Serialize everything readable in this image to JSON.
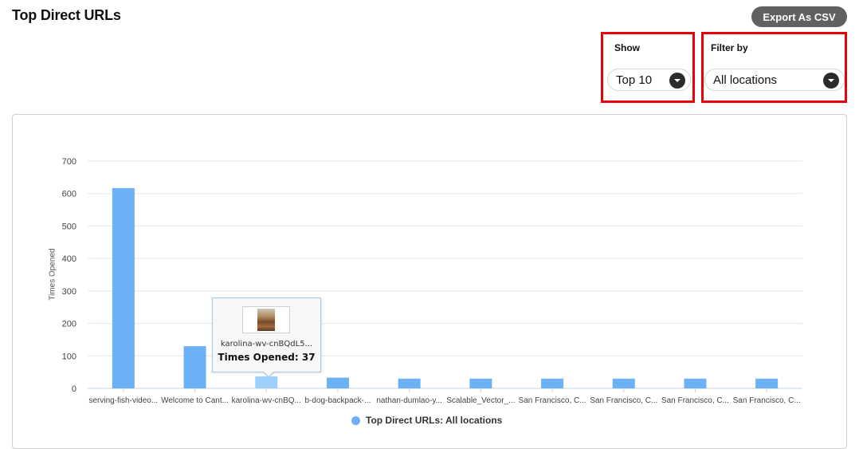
{
  "header": {
    "title": "Top Direct URLs",
    "export_label": "Export As CSV"
  },
  "controls": {
    "show_label": "Show",
    "show_value": "Top 10",
    "filter_label": "Filter by",
    "filter_value": "All locations"
  },
  "colors": {
    "bar": "#6cb0f5",
    "bar_hover": "#9fd0fb",
    "highlight_border": "#e8000b"
  },
  "tooltip": {
    "url": "karolina-wv-cnBQdL5...",
    "count_text": "Times Opened: 37"
  },
  "chart_data": {
    "type": "bar",
    "categories": [
      "serving-fish-video...",
      "Welcome to Cant...",
      "karolina-wv-cnBQ...",
      "b-dog-backpack-...",
      "nathan-dumlao-y...",
      "Scalable_Vector_...",
      "San Francisco, C...",
      "San Francisco, C...",
      "San Francisco, C...",
      "San Francisco, C..."
    ],
    "series": [
      {
        "name": "Top Direct URLs: All locations",
        "values": [
          617,
          130,
          37,
          33,
          30,
          30,
          30,
          30,
          30,
          30
        ]
      }
    ],
    "ylabel": "Times Opened",
    "ylim": [
      0,
      700
    ],
    "yticks": [
      0,
      100,
      200,
      300,
      400,
      500,
      600,
      700
    ],
    "highlighted_index": 2,
    "grid": true,
    "legend_position": "bottom"
  }
}
